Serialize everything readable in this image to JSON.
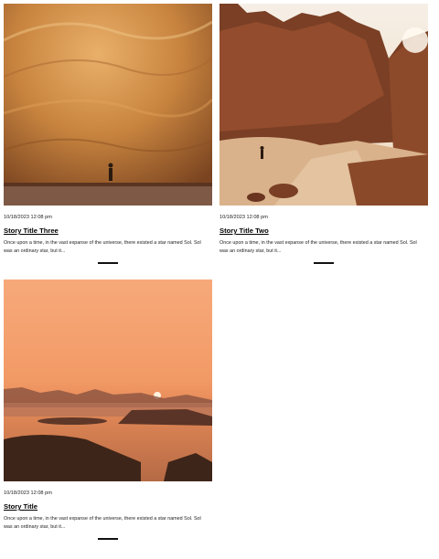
{
  "posts": [
    {
      "date": "10/18/2023 12:08 pm",
      "title": "Story Title Three",
      "excerpt": "Once upon a time, in the vast expanse of the universe, there existed a star named Sol. Sol was an ordinary star, but it...",
      "image": "canyon-cliff-photo"
    },
    {
      "date": "10/18/2023 12:08 pm",
      "title": "Story Title Two",
      "excerpt": "Once upon a time, in the vast expanse of the universe, there existed a star named Sol. Sol was an ordinary star, but it...",
      "image": "desert-canyon-path-photo"
    },
    {
      "date": "10/18/2023 12:08 pm",
      "title": "Story Title",
      "excerpt": "Once upon a time, in the vast expanse of the universe, there existed a star named Sol. Sol was an ordinary star, but it...",
      "image": "desert-sunset-photo"
    }
  ],
  "colors": {
    "text": "#111111",
    "background": "#ffffff",
    "cliff": "#c98a45",
    "sunset": "#f2a56c"
  }
}
